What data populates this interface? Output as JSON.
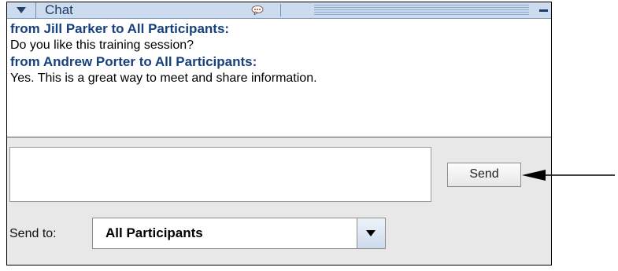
{
  "chat": {
    "title": "Chat",
    "icons": {
      "collapse": "chevron-down-icon",
      "bubble": "chat-bubble-icon",
      "minimize": "minimize-icon"
    },
    "messages": [
      {
        "from": "from Jill Parker to All Participants:",
        "text": "Do you like this training session?"
      },
      {
        "from": "from Andrew Porter to All Participants:",
        "text": "Yes. This is a great way to meet and share information."
      }
    ],
    "input": {
      "value": "",
      "placeholder": ""
    },
    "send_label": "Send",
    "send_to_label": "Send to:",
    "send_to_value": "All Participants"
  },
  "colors": {
    "titlebar": "#ccdbee",
    "sender": "#17417e"
  }
}
